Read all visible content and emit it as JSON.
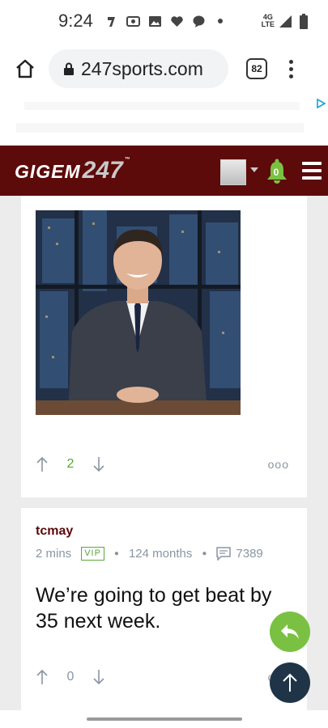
{
  "status_bar": {
    "time": "9:24",
    "network_top": "4G",
    "network_bottom": "LTE"
  },
  "browser": {
    "url": "247sports.com",
    "tab_count": "82"
  },
  "site": {
    "logo_text": "GIGEM",
    "logo_number": "247",
    "logo_tm": "™",
    "notification_count": "0",
    "colors": {
      "maroon": "#5c0a0a",
      "green": "#7ac143",
      "navy": "#1f3547"
    }
  },
  "post1": {
    "vote_count": "2",
    "more_label": "ooo"
  },
  "post2": {
    "username": "tcmay",
    "time_ago": "2 mins",
    "badge": "VIP",
    "tenure": "124 months",
    "post_count": "7389",
    "text": "We’re going to get beat by 35 next week.",
    "vote_count": "0",
    "more_label": "ooo"
  }
}
